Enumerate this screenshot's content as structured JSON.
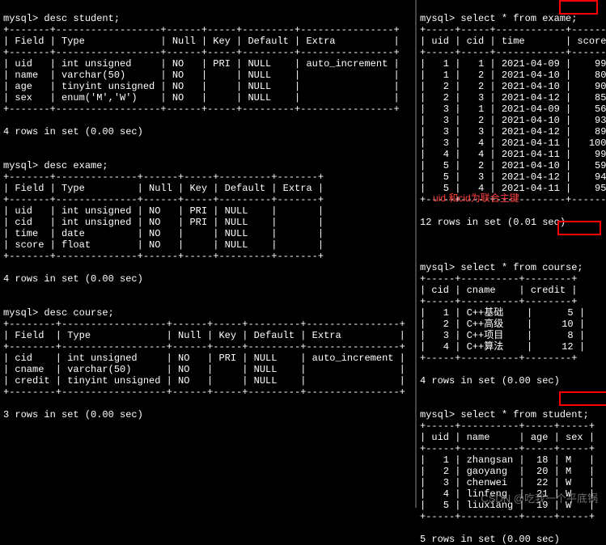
{
  "left_pane": {
    "cmd_desc_student": "mysql> desc student;",
    "desc_student": {
      "headers": [
        "Field",
        "Type",
        "Null",
        "Key",
        "Default",
        "Extra"
      ],
      "rows": [
        [
          "uid",
          "int unsigned",
          "NO",
          "PRI",
          "NULL",
          "auto_increment"
        ],
        [
          "name",
          "varchar(50)",
          "NO",
          "",
          "NULL",
          ""
        ],
        [
          "age",
          "tinyint unsigned",
          "NO",
          "",
          "NULL",
          ""
        ],
        [
          "sex",
          "enum('M','W')",
          "NO",
          "",
          "NULL",
          ""
        ]
      ],
      "status": "4 rows in set (0.00 sec)"
    },
    "cmd_desc_exame": "mysql> desc exame;",
    "desc_exame": {
      "headers": [
        "Field",
        "Type",
        "Null",
        "Key",
        "Default",
        "Extra"
      ],
      "rows": [
        [
          "uid",
          "int unsigned",
          "NO",
          "PRI",
          "NULL",
          ""
        ],
        [
          "cid",
          "int unsigned",
          "NO",
          "PRI",
          "NULL",
          ""
        ],
        [
          "time",
          "date",
          "NO",
          "",
          "NULL",
          ""
        ],
        [
          "score",
          "float",
          "NO",
          "",
          "NULL",
          ""
        ]
      ],
      "status": "4 rows in set (0.00 sec)"
    },
    "cmd_desc_course": "mysql> desc course;",
    "desc_course": {
      "headers": [
        "Field",
        "Type",
        "Null",
        "Key",
        "Default",
        "Extra"
      ],
      "rows": [
        [
          "cid",
          "int unsigned",
          "NO",
          "PRI",
          "NULL",
          "auto_increment"
        ],
        [
          "cname",
          "varchar(50)",
          "NO",
          "",
          "NULL",
          ""
        ],
        [
          "credit",
          "tinyint unsigned",
          "NO",
          "",
          "NULL",
          ""
        ]
      ],
      "status": "3 rows in set (0.00 sec)"
    }
  },
  "right_pane": {
    "cmd_sel_exame": "mysql> select * from exame;",
    "sel_exame": {
      "headers": [
        "uid",
        "cid",
        "time",
        "score"
      ],
      "rows": [
        [
          "1",
          "1",
          "2021-04-09",
          "99"
        ],
        [
          "1",
          "2",
          "2021-04-10",
          "80"
        ],
        [
          "2",
          "2",
          "2021-04-10",
          "90"
        ],
        [
          "2",
          "3",
          "2021-04-12",
          "85"
        ],
        [
          "3",
          "1",
          "2021-04-09",
          "56"
        ],
        [
          "3",
          "2",
          "2021-04-10",
          "93"
        ],
        [
          "3",
          "3",
          "2021-04-12",
          "89"
        ],
        [
          "3",
          "4",
          "2021-04-11",
          "100"
        ],
        [
          "4",
          "4",
          "2021-04-11",
          "99"
        ],
        [
          "5",
          "2",
          "2021-04-10",
          "59"
        ],
        [
          "5",
          "3",
          "2021-04-12",
          "94"
        ],
        [
          "5",
          "4",
          "2021-04-11",
          "95"
        ]
      ],
      "status": "12 rows in set (0.01 sec)"
    },
    "annotation1": "uid 和cid为联合主键",
    "cmd_sel_course": "mysql> select * from course;",
    "sel_course": {
      "headers": [
        "cid",
        "cname",
        "credit"
      ],
      "rows": [
        [
          "1",
          "C++基础",
          "5"
        ],
        [
          "2",
          "C++高级",
          "10"
        ],
        [
          "3",
          "C++项目",
          "8"
        ],
        [
          "4",
          "C++算法",
          "12"
        ]
      ],
      "status": "4 rows in set (0.00 sec)"
    },
    "cmd_sel_student": "mysql> select * from student;",
    "sel_student": {
      "headers": [
        "uid",
        "name",
        "age",
        "sex"
      ],
      "rows": [
        [
          "1",
          "zhangsan",
          "18",
          "M"
        ],
        [
          "2",
          "gaoyang",
          "20",
          "M"
        ],
        [
          "3",
          "chenwei",
          "22",
          "W"
        ],
        [
          "4",
          "linfeng",
          "21",
          "W"
        ],
        [
          "5",
          "liuxiang",
          "19",
          "W"
        ]
      ],
      "status": "5 rows in set (0.00 sec)"
    },
    "watermark": "CSDN @吃我一个平底锅"
  }
}
